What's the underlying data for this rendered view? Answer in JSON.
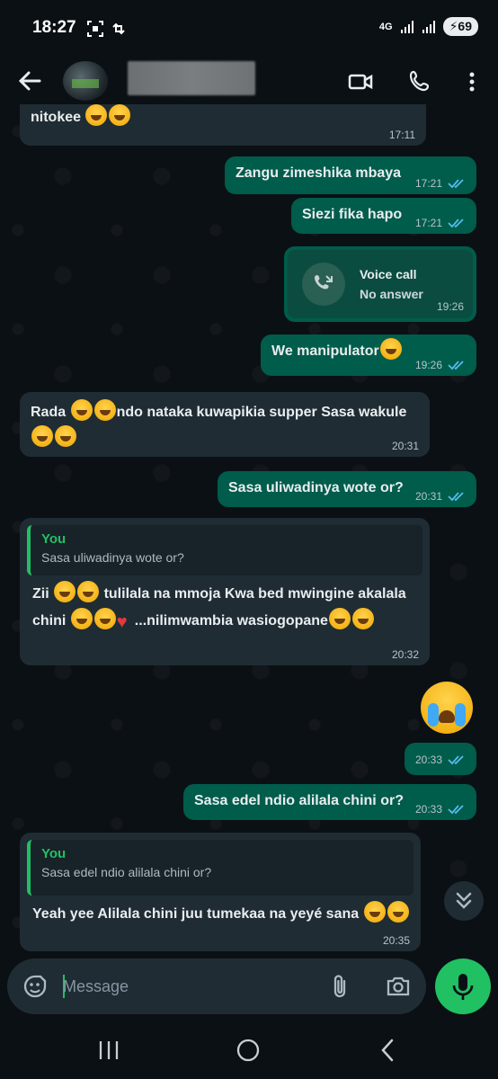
{
  "status_bar": {
    "time": "18:27",
    "network": "4G",
    "battery": "69"
  },
  "header": {
    "icons": [
      "back-arrow-icon",
      "video-call-icon",
      "phone-icon",
      "more-vert-icon"
    ]
  },
  "messages": [
    {
      "text": "nitokee",
      "time": "17:11"
    },
    {
      "text": "Zangu zimeshika mbaya",
      "time": "17:21"
    },
    {
      "text": "Siezi fika hapo",
      "time": "17:21"
    },
    {
      "call_title": "Voice call",
      "call_sub": "No answer",
      "time": "19:26"
    },
    {
      "text": "We manipulator",
      "time": "19:26"
    },
    {
      "text1": "Rada",
      "text2": "ndo nataka kuwapikia supper Sasa wakule",
      "time": "20:31"
    },
    {
      "text": "Sasa uliwadinya wote or?",
      "time": "20:31"
    },
    {
      "quote_author": "You",
      "quote_text": "Sasa uliwadinya wote or?",
      "text1": "Zii",
      "text2": "tulilala na mmoja Kwa bed mwingine akalala",
      "text3": "chini",
      "text4": "...nilimwambia wasiogopane",
      "time": "20:32"
    },
    {
      "emoji": "loudly-crying-face",
      "time": "20:33"
    },
    {
      "text": "Sasa edel ndio alilala chini or?",
      "time": "20:33"
    },
    {
      "quote_author": "You",
      "quote_text": "Sasa edel ndio alilala chini or?",
      "text": "Yeah yee Alilala chini juu tumekaa na yeyé sana",
      "time": "20:35"
    }
  ],
  "composer": {
    "placeholder": "Message"
  },
  "colors": {
    "incoming": "#1f2c34",
    "outgoing": "#005c4b",
    "accent": "#21c063",
    "read_ticks": "#53bdeb",
    "background": "#0b1014"
  }
}
